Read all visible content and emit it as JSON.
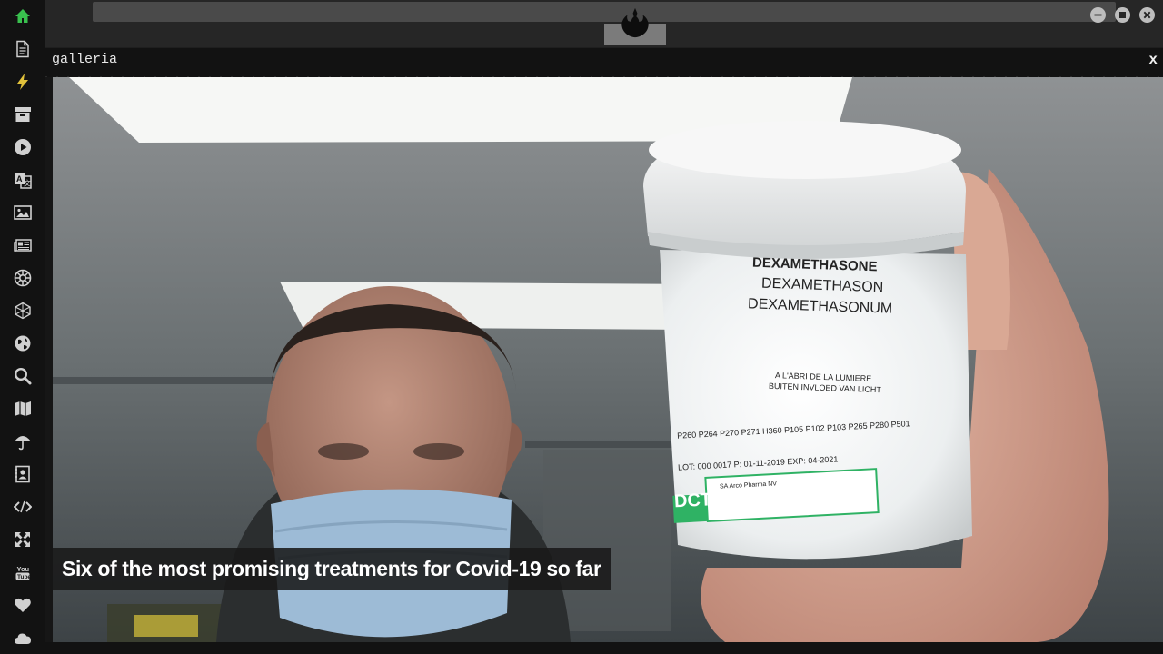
{
  "window": {
    "minimize_icon": "minimize-icon",
    "maximize_icon": "maximize-icon",
    "close_icon": "close-icon",
    "emblem_icon": "rebel-alliance-icon"
  },
  "sidebar": {
    "items": [
      {
        "icon": "home-icon",
        "color": "#39c04e"
      },
      {
        "icon": "document-icon",
        "color": "#d0d0d0"
      },
      {
        "icon": "lightning-icon",
        "color": "#e2c23b"
      },
      {
        "icon": "archive-icon",
        "color": "#d0d0d0"
      },
      {
        "icon": "play-circle-icon",
        "color": "#d0d0d0"
      },
      {
        "icon": "translate-icon",
        "color": "#d0d0d0"
      },
      {
        "icon": "image-icon",
        "color": "#d0d0d0"
      },
      {
        "icon": "newspaper-icon",
        "color": "#d0d0d0"
      },
      {
        "icon": "empire-icon",
        "color": "#d0d0d0"
      },
      {
        "icon": "hexagon-icon",
        "color": "#d0d0d0"
      },
      {
        "icon": "globe-icon",
        "color": "#d0d0d0"
      },
      {
        "icon": "search-icon",
        "color": "#d0d0d0"
      },
      {
        "icon": "map-icon",
        "color": "#d0d0d0"
      },
      {
        "icon": "umbrella-icon",
        "color": "#d0d0d0"
      },
      {
        "icon": "contact-icon",
        "color": "#d0d0d0"
      },
      {
        "icon": "code-icon",
        "color": "#d0d0d0"
      },
      {
        "icon": "expand-icon",
        "color": "#d0d0d0"
      },
      {
        "icon": "youtube-icon",
        "color": "#d0d0d0"
      },
      {
        "icon": "heart-icon",
        "color": "#d0d0d0"
      },
      {
        "icon": "cloud-icon",
        "color": "#d0d0d0"
      }
    ]
  },
  "panel": {
    "title": "galleria",
    "close_label": "x"
  },
  "gallery": {
    "caption": "Six of the most promising treatments for Covid-19 so far",
    "photo": {
      "label_line1": "DEXAMETHASONE",
      "label_line2": "DEXAMETHASON",
      "label_line3": "DEXAMETHASONUM",
      "label_storage1": "A L'ABRI DE LA LUMIERE",
      "label_storage2": "BUITEN INVLOED VAN LICHT",
      "label_codes": "P260 P264 P270 P271 H360 P105 P102 P103 P265 P280 P501",
      "label_lot": "LOT: 000 0017 P: 01-11-2019 EXP: 04-2021",
      "label_logo": "DCTA",
      "label_vendor": "SA Arco Pharma NV"
    }
  },
  "colors": {
    "background": "#141414",
    "sidebar_active": "#39c04e",
    "sidebar_lightning": "#e2c23b",
    "caption_bg": "#191919",
    "label_green": "#2fb264"
  }
}
